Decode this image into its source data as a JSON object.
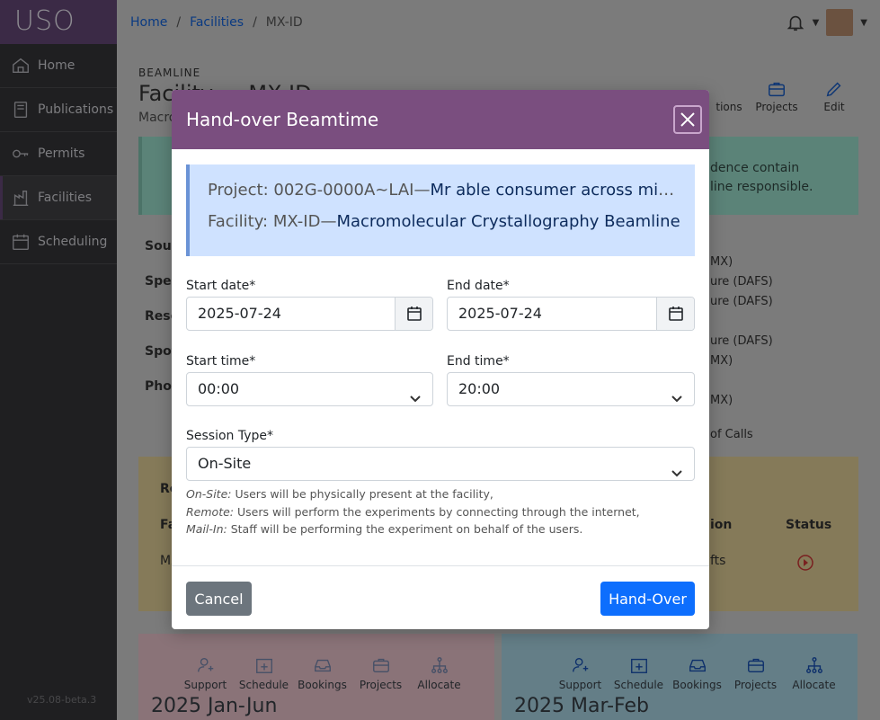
{
  "app": {
    "brand": "USO",
    "version": "v25.08-beta.3"
  },
  "sidebar": {
    "items": [
      {
        "label": "Home",
        "icon": "home-icon"
      },
      {
        "label": "Publications",
        "icon": "book-icon"
      },
      {
        "label": "Permits",
        "icon": "key-icon"
      },
      {
        "label": "Facilities",
        "icon": "building-icon"
      },
      {
        "label": "Scheduling",
        "icon": "calendar-icon"
      }
    ]
  },
  "breadcrumb": {
    "home": "Home",
    "facilities": "Facilities",
    "current": "MX-ID"
  },
  "background": {
    "kicker": "BEAMLINE",
    "title": "Facility — MX-ID",
    "subtitle": "Macro",
    "toolbar": [
      "",
      "",
      "",
      "Publications",
      "Projects",
      "Edit"
    ],
    "toolbar_visible": {
      "publications": "tions",
      "projects": "Projects",
      "edit": "Edit"
    },
    "alert_lines": [
      "dence contain",
      "line responsible."
    ],
    "left_labels": [
      "Sour",
      "Spec",
      "Reso",
      "Spot",
      "Phot"
    ],
    "right_items": [
      "MX)",
      "ure (DAFS)",
      "ure (DAFS)",
      "",
      "ure (DAFS)",
      "MX)",
      "",
      "MX)",
      "",
      "of Calls"
    ],
    "yellow": {
      "row_label": "Re",
      "col_fa": "Fa",
      "col_mx": "MX",
      "col_action": "ion",
      "col_status": "Status",
      "shifts": "fts"
    },
    "cards": [
      {
        "title": "2025 Jan-Jun",
        "tools": [
          "Support",
          "Schedule",
          "Bookings",
          "Projects",
          "Allocate"
        ]
      },
      {
        "title": "2025 Mar-Feb",
        "tools": [
          "Support",
          "Schedule",
          "Bookings",
          "Projects",
          "Allocate"
        ]
      }
    ]
  },
  "modal": {
    "title": "Hand-over Beamtime",
    "project_prefix": "Project: 002G-0000A~LAI—",
    "project_name": "Mr able consumer across might cause",
    "facility_prefix": "Facility: MX-ID—",
    "facility_name": "Macromolecular Crystallography Beamline",
    "start_date_label": "Start date*",
    "start_date": "2025-07-24",
    "end_date_label": "End date*",
    "end_date": "2025-07-24",
    "start_time_label": "Start time*",
    "start_time": "00:00",
    "end_time_label": "End time*",
    "end_time": "20:00",
    "session_type_label": "Session Type*",
    "session_type": "On-Site",
    "help": [
      {
        "term": "On-Site:",
        "text": " Users will be physically present at the facility,"
      },
      {
        "term": "Remote:",
        "text": " Users will perform the experiments by connecting through the internet,"
      },
      {
        "term": "Mail-In:",
        "text": " Staff will be performing the experiment on behalf of the users."
      }
    ],
    "cancel_label": "Cancel",
    "submit_label": "Hand-Over"
  }
}
